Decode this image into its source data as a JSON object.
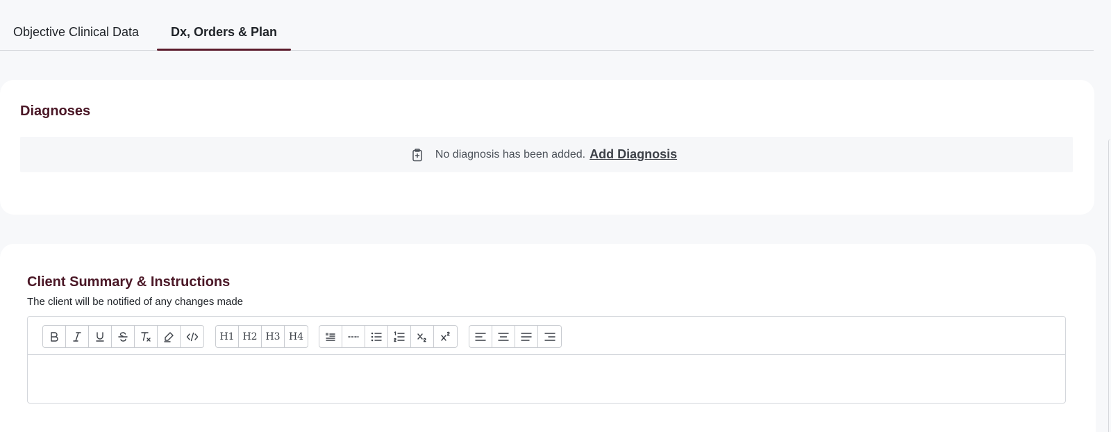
{
  "tabs": [
    {
      "label": "Objective Clinical Data",
      "active": false
    },
    {
      "label": "Dx, Orders & Plan",
      "active": true
    }
  ],
  "colors": {
    "accent": "#5b1a2b",
    "title": "#4a1726"
  },
  "diagnoses": {
    "title": "Diagnoses",
    "empty_text": "No diagnosis has been added.",
    "add_link": "Add Diagnosis",
    "icon": "clipboard-plus-icon"
  },
  "client_summary": {
    "title": "Client Summary & Instructions",
    "subtitle": "The client will be notified of any changes made",
    "editor_value": ""
  },
  "toolbar": {
    "headings": [
      "H1",
      "H2",
      "H3",
      "H4"
    ],
    "icons": [
      "bold-icon",
      "italic-icon",
      "underline-icon",
      "strikethrough-icon",
      "clear-format-icon",
      "highlight-icon",
      "code-icon",
      "blockquote-icon",
      "horizontal-rule-icon",
      "bullet-list-icon",
      "ordered-list-icon",
      "subscript-icon",
      "superscript-icon",
      "align-left-icon",
      "align-center-icon",
      "align-justify-icon",
      "align-right-icon"
    ]
  }
}
